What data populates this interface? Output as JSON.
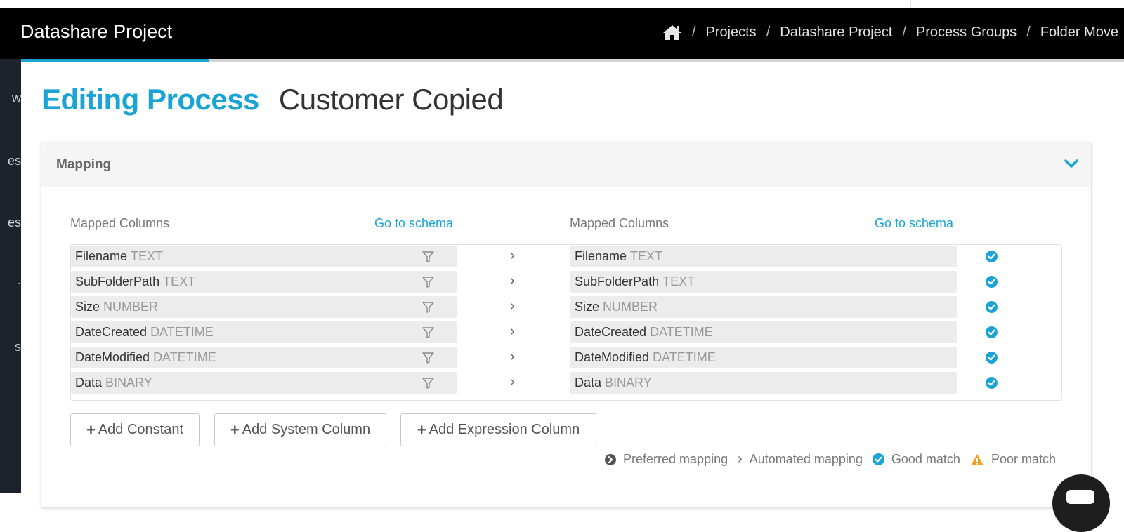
{
  "app": {
    "brand": "Datashare Project"
  },
  "breadcrumb": {
    "home_icon": "home-icon",
    "items": [
      "Projects",
      "Datashare Project",
      "Process Groups",
      "Folder Move"
    ],
    "separator": "/"
  },
  "sidebar": {
    "items": [
      "w",
      "es",
      "es",
      ".",
      "s"
    ]
  },
  "progress": {
    "fraction": 0.17
  },
  "page": {
    "title_prefix": "Editing Process",
    "title_name": "Customer Copied"
  },
  "panel": {
    "title": "Mapping",
    "toggle_icon": "chevron-down-icon"
  },
  "mapping": {
    "left_header": "Mapped Columns",
    "left_link": "Go to schema",
    "right_header": "Mapped Columns",
    "right_link": "Go to schema",
    "rows": [
      {
        "left_name": "Filename",
        "left_type": "TEXT",
        "right_name": "Filename",
        "right_type": "TEXT",
        "status": "good"
      },
      {
        "left_name": "SubFolderPath",
        "left_type": "TEXT",
        "right_name": "SubFolderPath",
        "right_type": "TEXT",
        "status": "good"
      },
      {
        "left_name": "Size",
        "left_type": "NUMBER",
        "right_name": "Size",
        "right_type": "NUMBER",
        "status": "good"
      },
      {
        "left_name": "DateCreated",
        "left_type": "DATETIME",
        "right_name": "DateCreated",
        "right_type": "DATETIME",
        "status": "good"
      },
      {
        "left_name": "DateModified",
        "left_type": "DATETIME",
        "right_name": "DateModified",
        "right_type": "DATETIME",
        "status": "good"
      },
      {
        "left_name": "Data",
        "left_type": "BINARY",
        "right_name": "Data",
        "right_type": "BINARY",
        "status": "good"
      }
    ],
    "arrow_glyph": "›"
  },
  "buttons": {
    "add_constant": "Add Constant",
    "add_system_column": "Add System Column",
    "add_expression_column": "Add Expression Column"
  },
  "legend": {
    "preferred": "Preferred mapping",
    "automated": "Automated mapping",
    "good": "Good match",
    "poor": "Poor match",
    "automated_glyph": "›"
  },
  "colors": {
    "accent": "#1aa4d6",
    "warning": "#f0a21e",
    "navbar": "#000000",
    "sidebar": "#1d232b"
  }
}
